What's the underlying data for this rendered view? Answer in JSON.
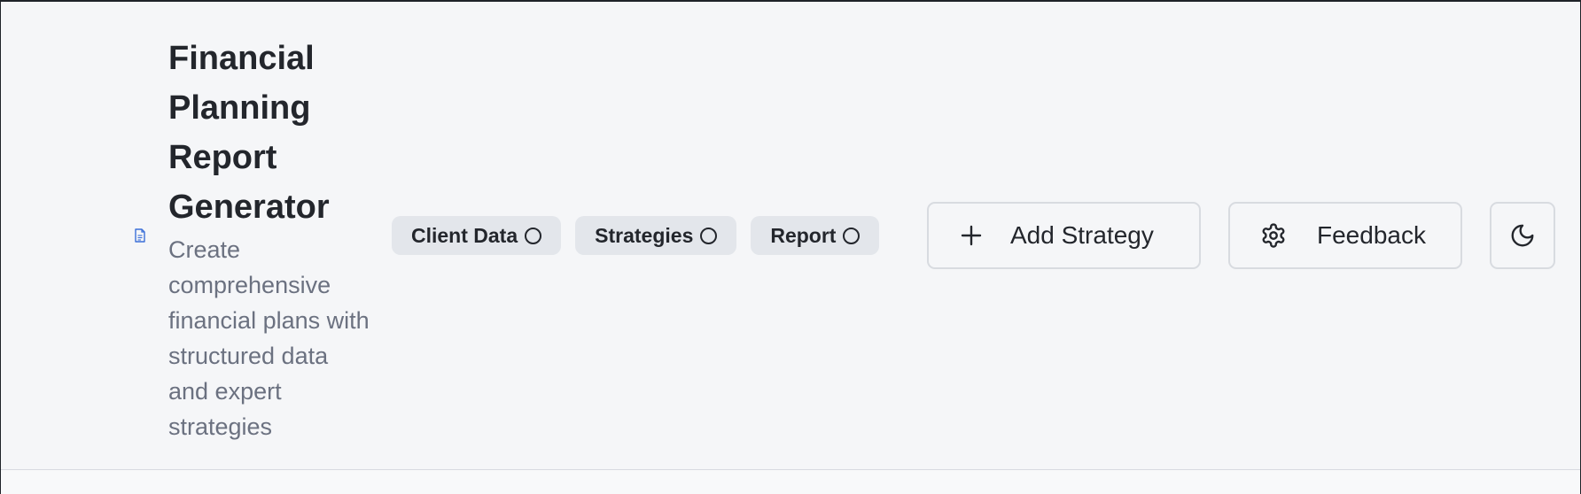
{
  "header": {
    "title": "Financial Planning Report Generator",
    "subtitle": "Create comprehensive financial plans with structured data and expert strategies"
  },
  "progress_steps": [
    {
      "label": "Client Data",
      "status": "incomplete"
    },
    {
      "label": "Strategies",
      "status": "incomplete"
    },
    {
      "label": "Report",
      "status": "incomplete"
    }
  ],
  "actions": {
    "add_strategy_label": "Add Strategy",
    "feedback_label": "Feedback"
  },
  "icons": {
    "document": "document-icon",
    "plus": "plus-icon",
    "settings": "gear-icon",
    "theme": "moon-icon"
  },
  "colors": {
    "accent_icon": "#3b6fd8",
    "badge_bg": "#e3e6eb",
    "text_primary": "#23262c",
    "text_secondary": "#6b7180"
  }
}
